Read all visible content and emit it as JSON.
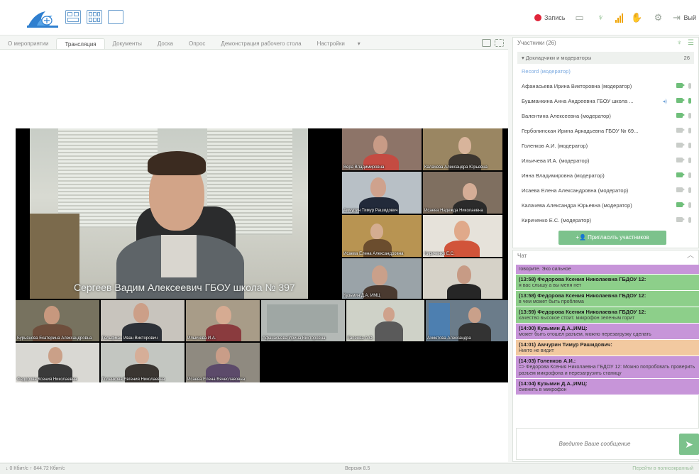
{
  "toolbar": {
    "record_label": "Запись",
    "exit_label": "Вый"
  },
  "tabs": [
    {
      "label": "О мероприятии",
      "active": false
    },
    {
      "label": "Трансляция",
      "active": true
    },
    {
      "label": "Документы",
      "active": false
    },
    {
      "label": "Доска",
      "active": false
    },
    {
      "label": "Опрос",
      "active": false
    },
    {
      "label": "Демонстрация рабочего стола",
      "active": false
    },
    {
      "label": "Настройки",
      "active": false
    }
  ],
  "tab_dropdown": "▾",
  "video": {
    "speaker": "Сергеев Вадим Алексеевич ГБОУ школа № 397",
    "tiles": [
      "Вера Владимировна",
      "Калачева Александра Юрьевна",
      "Амчурин Тимур Рашидович",
      "Исаева Надежда Николаевна",
      "Исаева Елена Александровна",
      "Кириченко Е.С.",
      "Кузьмин Д.А. ИМЦ",
      "Бурьянова Екатерина Александровна",
      "Гельфман Иван Викторович",
      "Ильичева И.А.",
      "Афанасьева Ирина Викторовна",
      "Гапеева А.О.",
      "Ахметова Александра",
      "Федорова Ксения Николаевна",
      "Голенкова Евгения Николаевна",
      "Исаева Елена Вячеславовна"
    ]
  },
  "participants": {
    "header": "Участники (26)",
    "group_label": "Докладчики и модераторы",
    "group_count": "26",
    "record_row": "Record (модератор)",
    "rows": [
      {
        "name": "Афанасьева Ирина Викторовна (модератор)",
        "speaking": false
      },
      {
        "name": "Бушманкина Анна Андреевна ГБОУ школа ...",
        "speaking": true
      },
      {
        "name": "Валентина Алексеевна (модератор)",
        "speaking": false
      },
      {
        "name": "Герболинская Ирина Аркадьевна ГБОУ № 69...",
        "speaking": false
      },
      {
        "name": "Голенков А.И. (модератор)",
        "speaking": false
      },
      {
        "name": "Ильичева И.А. (модератор)",
        "speaking": false
      },
      {
        "name": "Инна Владимировна (модератор)",
        "speaking": false
      },
      {
        "name": "Исаева Елена Александровна (модератор)",
        "speaking": false
      },
      {
        "name": "Калачева Александра Юрьевна (модератор)",
        "speaking": false
      },
      {
        "name": "Кириченко Е.С. (модератор)",
        "speaking": false
      }
    ],
    "invite_label": "Пригласить участников"
  },
  "chat": {
    "header": "Чат",
    "messages": [
      {
        "who": "",
        "text": "говорите. Эхо сильное",
        "color": "purple"
      },
      {
        "who": "(13:58) Федорова Ксения Николаевна ГБДОУ 12:",
        "text": "я вас слышу а вы меня нет",
        "color": "green"
      },
      {
        "who": "(13:58) Федорова Ксения Николаевна ГБДОУ 12:",
        "text": "в чем может быть проблема",
        "color": "green"
      },
      {
        "who": "(13:59) Федорова Ксения Николаевна ГБДОУ 12:",
        "text": "качество высокое стоит. микрофон зеленым горит",
        "color": "green"
      },
      {
        "who": "(14:00) Кузьмин Д.А.,ИМЦ:",
        "text": "может быть отошел разъем, можно перезагрузку сделать",
        "color": "purple"
      },
      {
        "who": "(14:01) Амчурин Тимур Рашидович:",
        "text": "Никто не видит",
        "color": "peach"
      },
      {
        "who": "(14:03) Голенков А.И.:",
        "text": "=> Федорова Ксения Николаевна ГБДОУ 12: Можно попробовать проверить разъем микрофона и перезагрузить станицу",
        "color": "purple"
      },
      {
        "who": "(14:04) Кузьмин Д.А.,ИМЦ:",
        "text": "сменить в микрофон",
        "color": "purple"
      }
    ],
    "input_placeholder": "Введите Ваше сообщение"
  },
  "status": {
    "left": "↓ 0 Кбит/с  ↑ 844.72 Кбит/с",
    "version": "Версия 8.5",
    "right": "Перейти в полноэкранный"
  },
  "colors": {
    "accent_green": "#7cc28c",
    "record_red": "#e0253a",
    "chat_purple": "#c795d9",
    "chat_green": "#8dcf8a",
    "chat_peach": "#f2c9a0"
  }
}
